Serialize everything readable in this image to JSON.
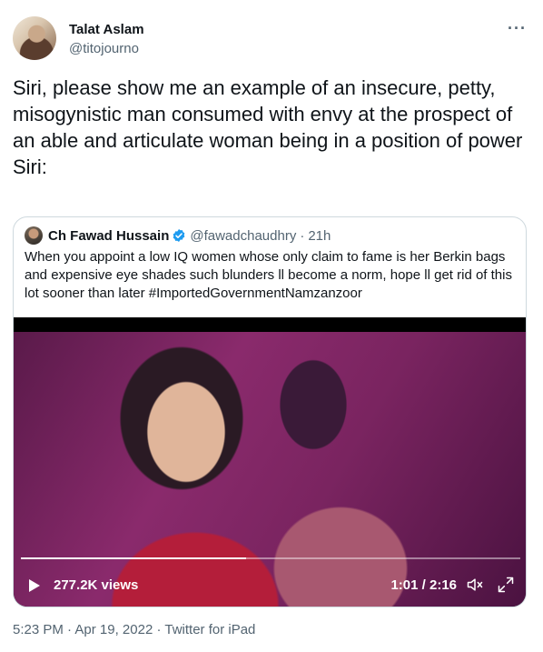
{
  "author": {
    "name": "Talat Aslam",
    "handle": "@titojourno"
  },
  "more_icon": "more-horizontal-icon",
  "tweet": {
    "text": "Siri, please show me an example of an insecure, petty, misogynistic man consumed with envy at the prospect of an able and articulate woman being in a position of power\nSiri:"
  },
  "quoted": {
    "name": "Ch Fawad Hussain",
    "handle": "@fawadchaudhry",
    "separator": "·",
    "time": "21h",
    "verified_color": "#1d9bf0",
    "text": "When you appoint a low IQ women whose only claim to fame is her Berkin bags and expensive eye shades such blunders ll become a norm, hope ll get rid of this lot sooner than later #ImportedGovernmentNamzanzoor"
  },
  "video": {
    "views": "277.2K views",
    "time": "1:01 / 2:16",
    "progress": 0.45
  },
  "footer": {
    "time": "5:23 PM",
    "sep1": " · ",
    "date": "Apr 19, 2022",
    "sep2": " · ",
    "source": "Twitter for iPad"
  }
}
